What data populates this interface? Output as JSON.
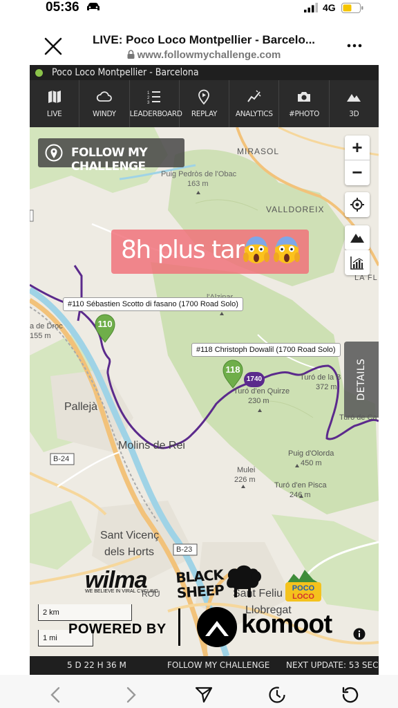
{
  "status": {
    "time": "05:36",
    "network": "4G"
  },
  "browser": {
    "title": "LIVE: Poco Loco Montpellier - Barcelo...",
    "url": "www.followmychallenge.com"
  },
  "app": {
    "title": "Poco Loco Montpellier - Barcelona",
    "toolbar": [
      "LIVE",
      "WINDY",
      "LEADERBOARD",
      "REPLAY",
      "ANALYTICS",
      "#PHOTO",
      "3D"
    ],
    "brand": "FOLLOW MY CHALLENGE",
    "promo": "8h plus tard",
    "details_label": "DETAILS",
    "riders": [
      {
        "pin": "110",
        "label": "#110 Sébastien Scotto di fasano (1700 Road Solo)"
      },
      {
        "pin": "118",
        "label": "#118 Christoph Dowalil (1700 Road Solo)",
        "bubble": "1740"
      }
    ],
    "places": {
      "mirasol": "MIRASOL",
      "puig_name": "Puig Pedròs de l'Obac",
      "puig_alt": "163 m",
      "valldoreix": "VALLDOREIX",
      "la_fl": "LA FL",
      "alzinar": "l'Alzinar",
      "droc": "a de Droc",
      "droc_alt": "155 m",
      "quirze": "Turó d'en Quirze",
      "quirze_alt": "230 m",
      "turo_de_la": "Turó de la B",
      "turo_de_la_alt": "372 m",
      "turo_de_ca": "Turó de Ca",
      "pallejà": "Pallejà",
      "molins": "Molins de Rei",
      "b24": "B-24",
      "b23": "B-23",
      "olorda": "Puig d'Olorda",
      "olorda_alt": "450 m",
      "mulei": "Mulei",
      "mulei_alt": "226 m",
      "pisca": "Turó d'en Pisca",
      "pisca_alt": "246 m",
      "vicenc1": "Sant Vicenç",
      "vicenc2": "dels Horts",
      "feliu1": "Sant Feliu de",
      "feliu2": "Llobregat",
      "rou": "ROU"
    },
    "scale": {
      "km": "2 km",
      "mi": "1 mi"
    },
    "sponsors": {
      "wilma": "wilma",
      "wilma_tag": "WE BELIEVE IN VIRAL CYCLING",
      "blacksheep": "BLACK SHEEP",
      "pocoloco": "POCO LOCO"
    },
    "powered_by": "POWERED BY",
    "komoot": "komoot",
    "bottom": {
      "elapsed": "5 D 22 H 36 M",
      "center": "FOLLOW MY CHALLENGE",
      "next_update": "NEXT UPDATE: 53 SEC"
    }
  },
  "colors": {
    "route": "#5b2a8c",
    "pin_green": "#6fae4a",
    "promo": "#f06e78",
    "forest": "#cfe0b6",
    "water": "#9fd3e6"
  }
}
